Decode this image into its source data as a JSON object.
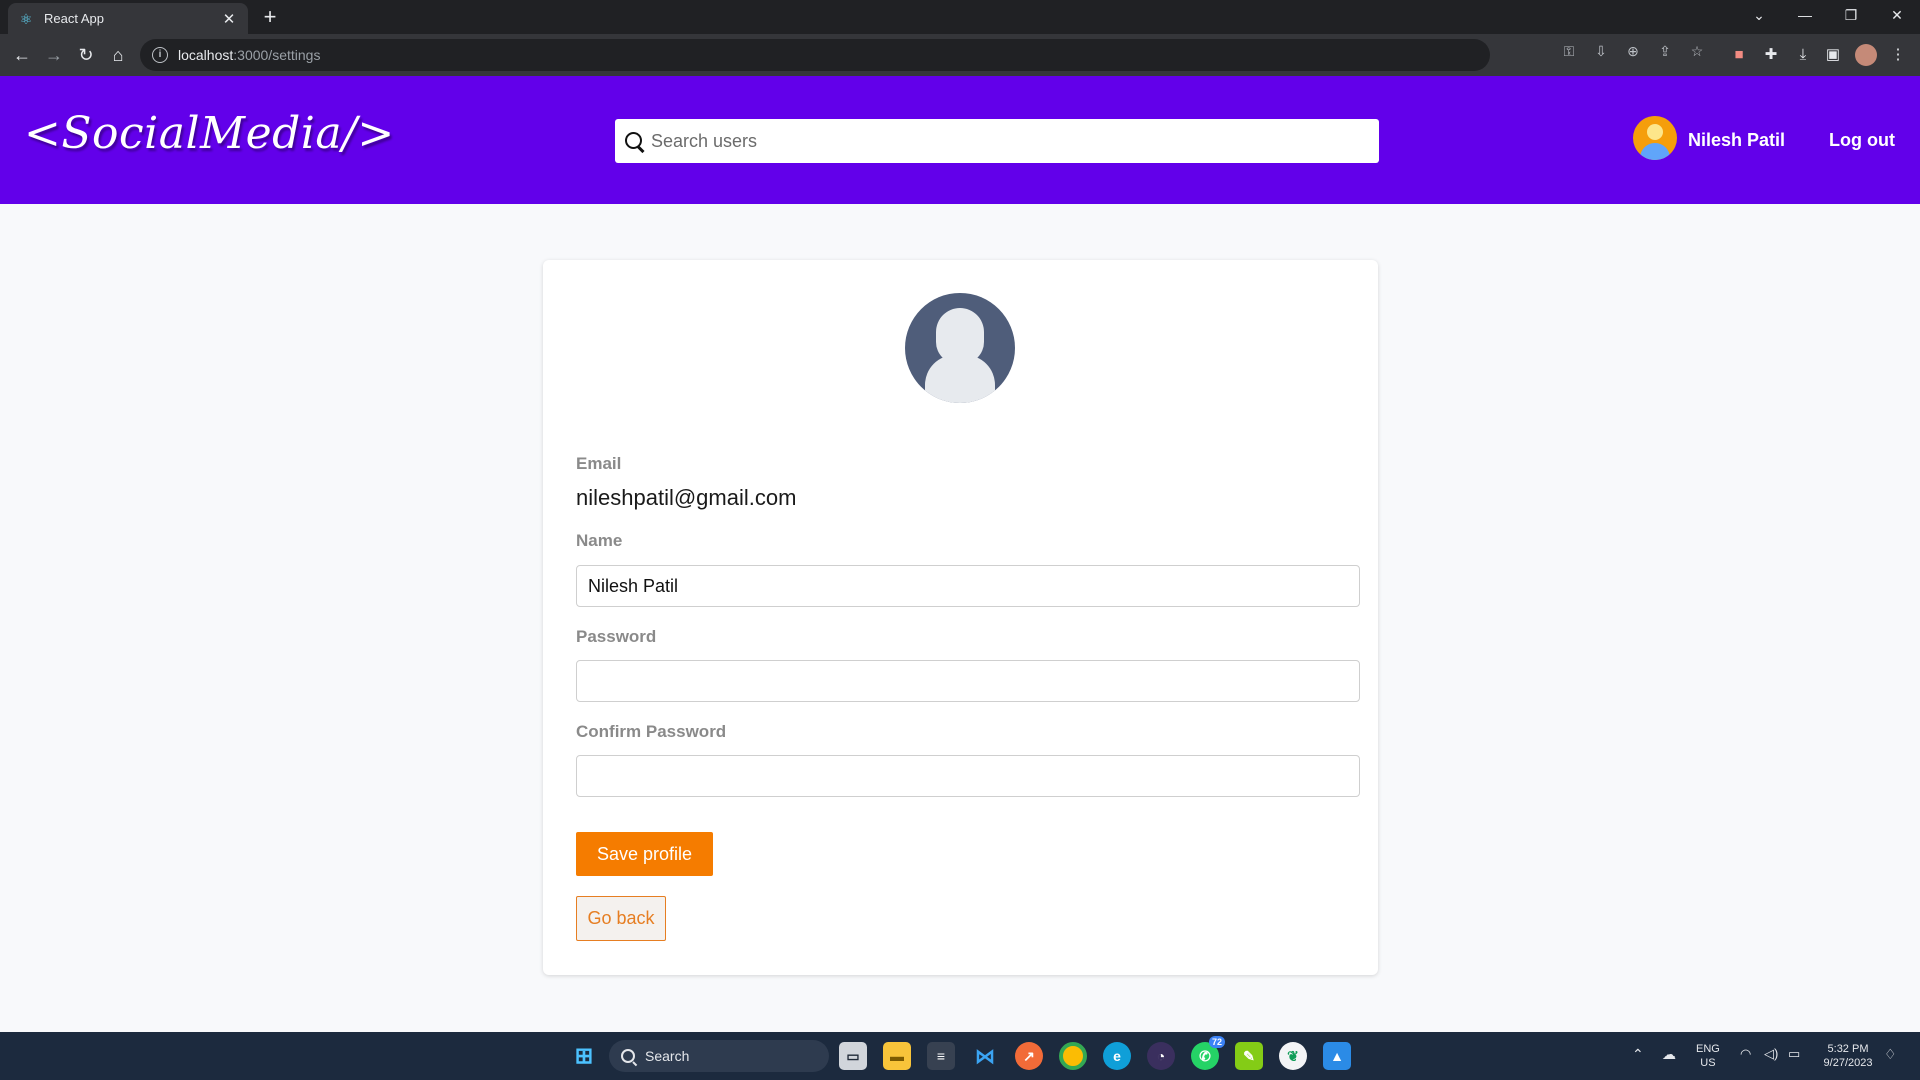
{
  "browser": {
    "tab_title": "React App",
    "url_host": "localhost",
    "url_path": ":3000/settings"
  },
  "header": {
    "logo": "<SocialMedia/>",
    "search_placeholder": "Search users",
    "username": "Nilesh Patil",
    "logout_label": "Log out"
  },
  "settings": {
    "email_label": "Email",
    "email_value": "nileshpatil@gmail.com",
    "name_label": "Name",
    "name_value": "Nilesh Patil",
    "password_label": "Password",
    "password_value": "",
    "confirm_password_label": "Confirm Password",
    "confirm_password_value": "",
    "save_label": "Save profile",
    "back_label": "Go back"
  },
  "taskbar": {
    "search_label": "Search",
    "lang_top": "ENG",
    "lang_bottom": "US",
    "time": "5:32 PM",
    "date": "9/27/2023",
    "whatsapp_badge": "72"
  },
  "colors": {
    "header_bg": "#6200ea",
    "accent": "#f57c00"
  }
}
